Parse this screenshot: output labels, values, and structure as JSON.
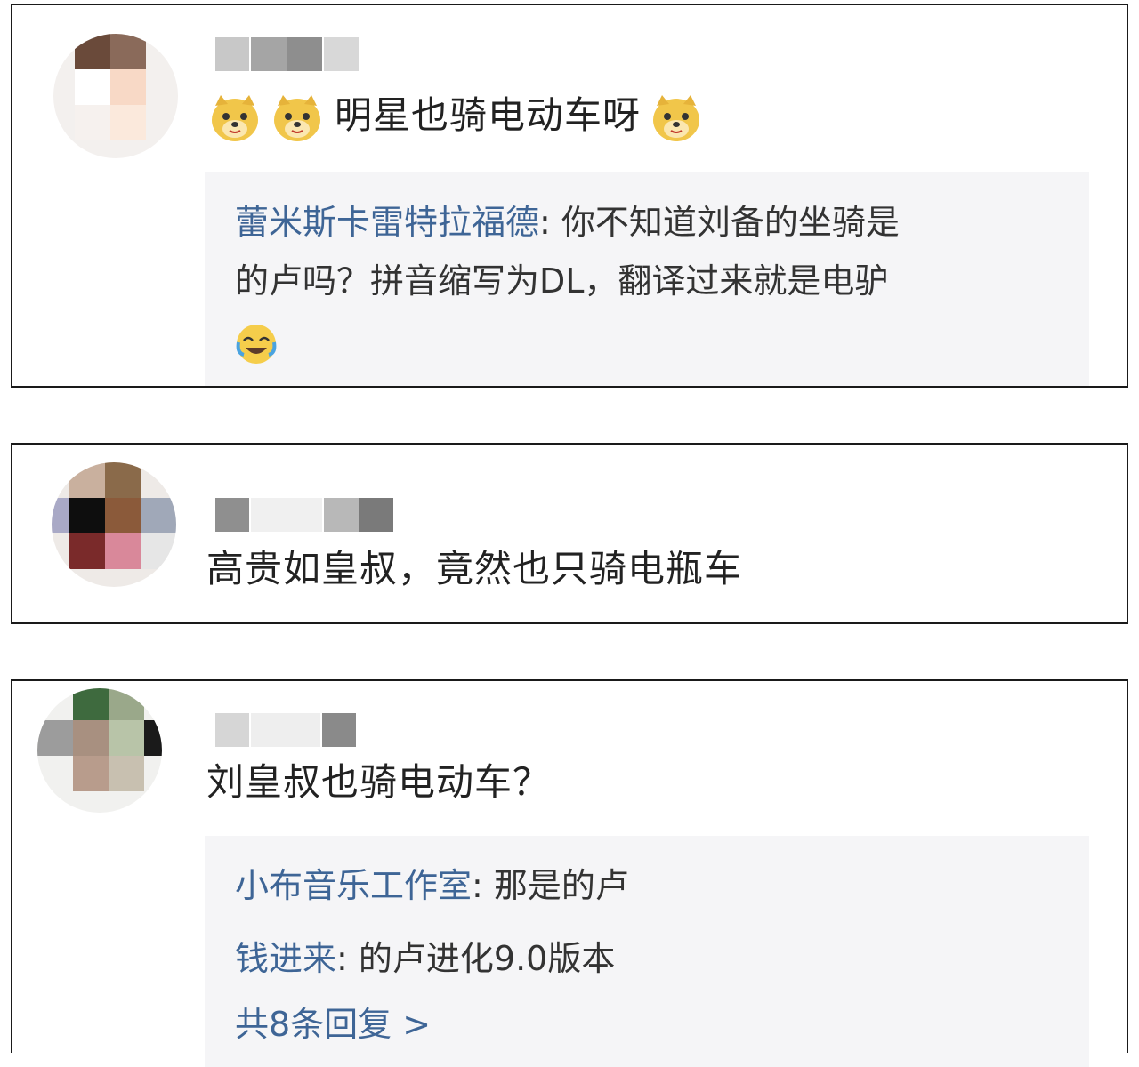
{
  "comments": [
    {
      "text": "明星也骑电动车呀",
      "emoji_icon": "doge-emoji",
      "replies_text": [
        {
          "name": "蕾米斯卡雷特拉福德",
          "sep": ": ",
          "line1": "你不知道刘备的坐骑是",
          "line2": "的卢吗？拼音缩写为DL，翻译过来就是电驴"
        }
      ],
      "reply_emoji_icon": "laugh-cry-emoji"
    },
    {
      "text": "高贵如皇叔，竟然也只骑电瓶车"
    },
    {
      "text": "刘皇叔也骑电动车？",
      "replies": [
        {
          "name": "小布音乐工作室",
          "sep": ": ",
          "text": "那是的卢"
        },
        {
          "name": "钱进来",
          "sep": ": ",
          "text": "的卢进化9.0版本"
        }
      ],
      "more_text": "共8条回复 >"
    }
  ],
  "colors": {
    "reply_name": "#3e6596",
    "reply_bg": "#f5f5f7",
    "border": "#1a1a1a"
  }
}
